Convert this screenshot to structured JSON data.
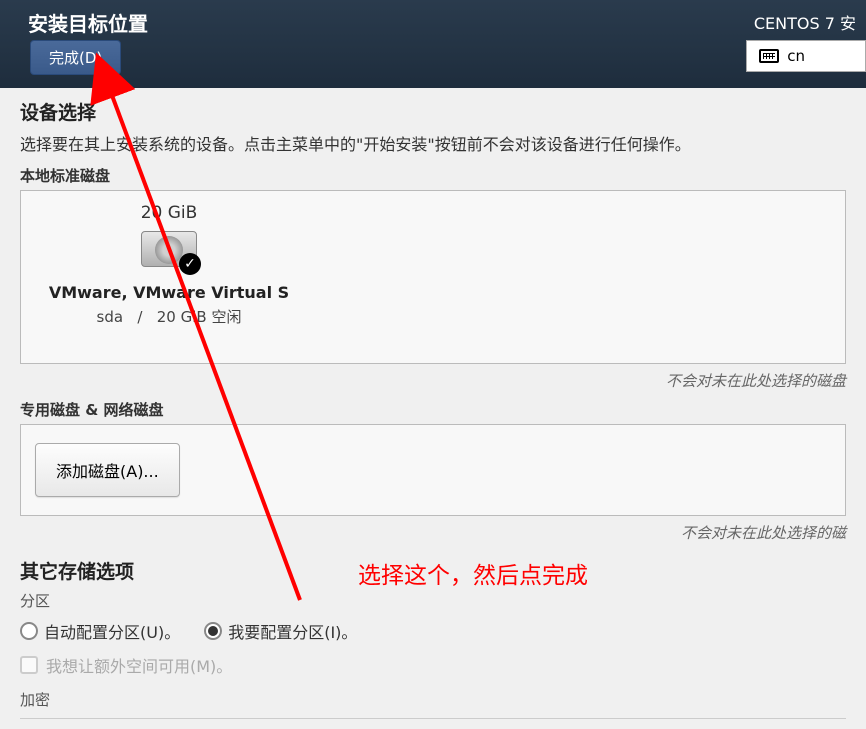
{
  "header": {
    "title": "安装目标位置",
    "done_button": "完成(D)",
    "os_title": "CENTOS 7 安",
    "lang_code": "cn"
  },
  "device_selection": {
    "title": "设备选择",
    "description": "选择要在其上安装系统的设备。点击主菜单中的\"开始安装\"按钮前不会对该设备进行任何操作。",
    "local_disks_label": "本地标准磁盘"
  },
  "disk": {
    "size": "20 GiB",
    "name": "VMware, VMware Virtual S",
    "device": "sda",
    "separator": "/",
    "free": "20 GiB 空闲"
  },
  "disk_footer": "不会对未在此处选择的磁盘",
  "network_disks": {
    "label": "专用磁盘 & 网络磁盘",
    "add_button": "添加磁盘(A)...",
    "footer": "不会对未在此处选择的磁"
  },
  "storage_options": {
    "title": "其它存储选项",
    "partition_label": "分区",
    "auto_option": "自动配置分区(U)。",
    "manual_option": "我要配置分区(I)。",
    "extra_space": "我想让额外空间可用(M)。",
    "encryption_label": "加密"
  },
  "annotation": {
    "text": "选择这个，然后点完成"
  }
}
